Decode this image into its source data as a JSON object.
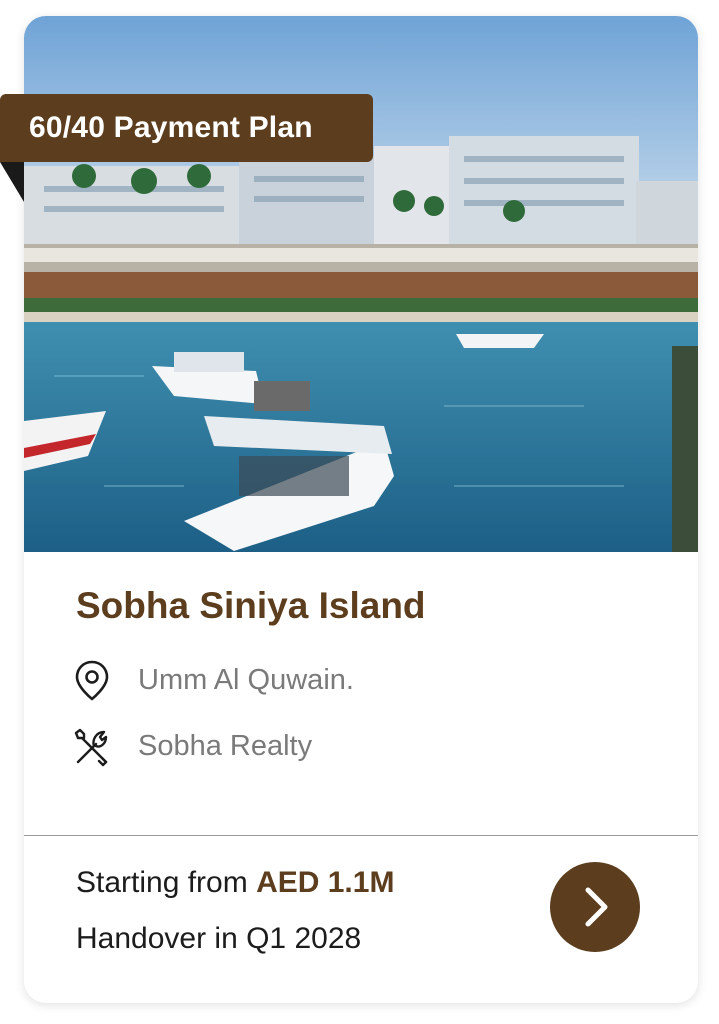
{
  "badge": {
    "label": "60/40 Payment Plan"
  },
  "project": {
    "title": "Sobha Siniya Island",
    "location": "Umm Al Quwain.",
    "developer": "Sobha  Realty"
  },
  "pricing": {
    "starting_prefix": "Starting from ",
    "starting_value": "AED 1.1M",
    "handover": "Handover in Q1 2028"
  },
  "icons": {
    "location": "map-pin-icon",
    "developer": "tools-icon",
    "next": "chevron-right-icon"
  },
  "colors": {
    "brand": "#5c3d1d",
    "text_muted": "#7a7a7a",
    "text_dark": "#1c1c1c"
  }
}
